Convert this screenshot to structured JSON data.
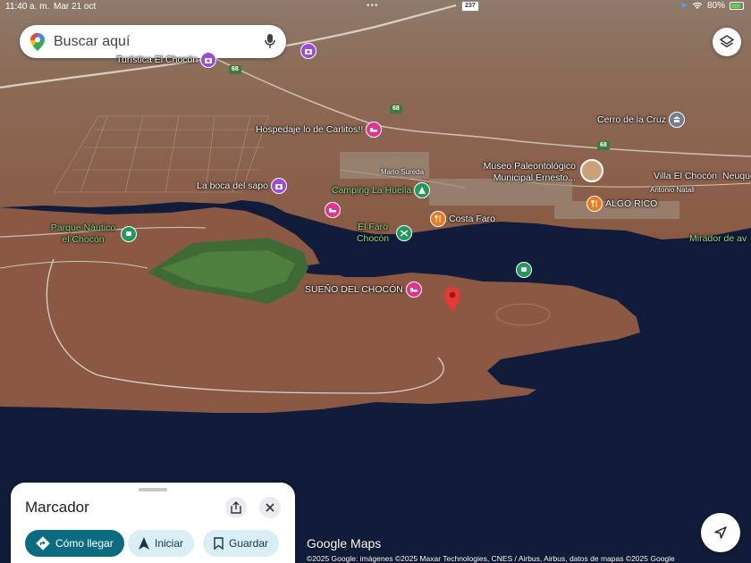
{
  "status_bar": {
    "time": "11:40 a. m.",
    "date": "Mar 21 oct",
    "dots": "•••",
    "battery": "80%"
  },
  "search": {
    "placeholder": "Buscar aquí"
  },
  "roads": {
    "r237": "237",
    "r68a": "68",
    "r68b": "68",
    "r68c": "68"
  },
  "streets": {
    "mario_sureda": "Mario Sureda",
    "antonio_natali": "Antonio Natali"
  },
  "pois": {
    "turistica": "Turística El Chocón",
    "hospedaje": "Hospedaje lo de Carlitos!!",
    "cerro": "Cerro de la Cruz",
    "museo": "Museo Paleontológico Municipal Ernesto...",
    "villa": "Villa El Chocón",
    "neuquen": "Neuque",
    "la_boca": "La boca del sapo",
    "camping": "Camping La Huella",
    "costa_faro": "Costa Faro",
    "algo_rico": "ALGO RICO",
    "parque": "Parque Náutico el Chocón",
    "el_faro": "El Faro Chocón",
    "mirador": "Mirador de av",
    "sueno": "SUEÑO DEL CHOCÓN"
  },
  "sheet": {
    "title": "Marcador",
    "directions_label": "Cómo llegar",
    "start_label": "Iniciar",
    "save_label": "Guardar"
  },
  "brand": "Google Maps",
  "attribution": "©2025 Google: imágenes ©2025 Maxar Technologies, CNES / Airbus, Airbus, datos de mapas ©2025 Google",
  "colors": {
    "water": "#101c3a",
    "land": "#8a5f48",
    "accent": "#0b6b80",
    "marker": "#e53935"
  },
  "icons": [
    "google-maps-pin-icon",
    "mic-icon",
    "layers-icon",
    "share-icon",
    "close-icon",
    "directions-icon",
    "navigation-icon",
    "bookmark-icon",
    "my-location-icon",
    "red-marker-icon"
  ]
}
